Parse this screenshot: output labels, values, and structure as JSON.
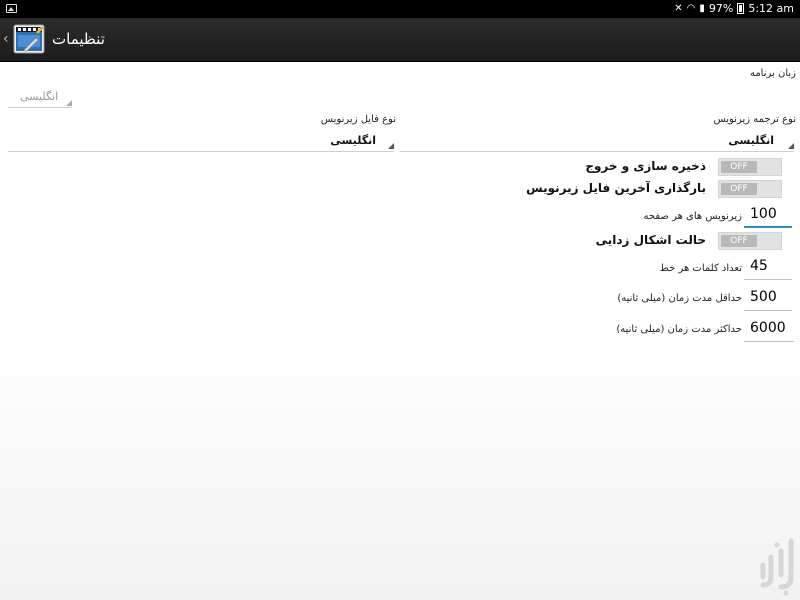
{
  "status_bar": {
    "battery": "97%",
    "time": "5:12 am"
  },
  "action_bar": {
    "title": "تنظیمات"
  },
  "settings": {
    "app_language": {
      "label": "زبان برنامه",
      "value": "انگلیسی"
    },
    "subtitle_file_type": {
      "label": "نوع فایل زیرنویس",
      "value": "انگلیسی"
    },
    "subtitle_translation_type": {
      "label": "نوع ترجمه زیرنویس",
      "value": "انگلیسی"
    },
    "save_and_exit": {
      "label": "ذخیره سازی و خروج",
      "state": "OFF"
    },
    "load_last_subtitle": {
      "label": "بارگذاری آخرین فایل زیرنویس",
      "state": "OFF"
    },
    "subtitles_per_page": {
      "label": "زیرنویس های هر صفحه",
      "value": "100"
    },
    "debug_mode": {
      "label": "حالت اشکال زدایی",
      "state": "OFF"
    },
    "words_per_line": {
      "label": "تعداد کلمات هر خط",
      "value": "45"
    },
    "min_duration": {
      "label": "حداقل مدت زمان (میلی ثانیه)",
      "value": "500"
    },
    "max_duration": {
      "label": "حداکثر مدت زمان (میلی ثانیه)",
      "value": "6000"
    }
  },
  "watermark": {
    "text": "بازار"
  },
  "colors": {
    "accent": "#2a8fbd",
    "toggle_off": "#b8b8b8",
    "action_bar": "#222222"
  }
}
